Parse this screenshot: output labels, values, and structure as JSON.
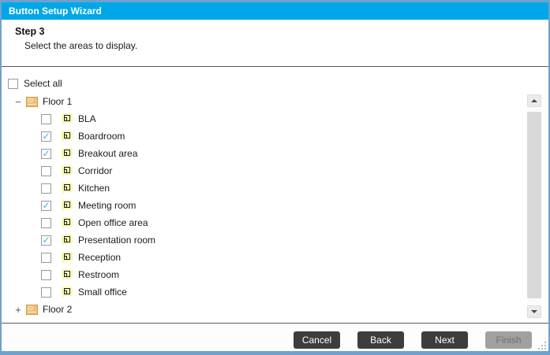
{
  "window": {
    "title": "Button Setup Wizard"
  },
  "header": {
    "step": "Step 3",
    "instruction": "Select the areas to display."
  },
  "select_all": {
    "label": "Select all",
    "checked": false
  },
  "tree": {
    "nodes": [
      {
        "label": "Floor 1",
        "expanded": true,
        "children": [
          {
            "label": "BLA",
            "checked": false
          },
          {
            "label": "Boardroom",
            "checked": true
          },
          {
            "label": "Breakout area",
            "checked": true
          },
          {
            "label": "Corridor",
            "checked": false
          },
          {
            "label": "Kitchen",
            "checked": false
          },
          {
            "label": "Meeting room",
            "checked": true
          },
          {
            "label": "Open office area",
            "checked": false
          },
          {
            "label": "Presentation room",
            "checked": true
          },
          {
            "label": "Reception",
            "checked": false
          },
          {
            "label": "Restroom",
            "checked": false
          },
          {
            "label": "Small office",
            "checked": false
          }
        ]
      },
      {
        "label": "Floor 2",
        "expanded": false,
        "children": []
      }
    ]
  },
  "icons": {
    "collapse_glyph": "−",
    "expand_glyph": "+",
    "check_glyph": "✓",
    "floor_icon": "floor-plan-icon",
    "area_icon": "area-icon",
    "scroll_up": "triangle-up",
    "scroll_down": "triangle-down"
  },
  "footer": {
    "buttons": [
      {
        "label": "Cancel",
        "enabled": true
      },
      {
        "label": "Back",
        "enabled": true
      },
      {
        "label": "Next",
        "enabled": true
      },
      {
        "label": "Finish",
        "enabled": false
      }
    ]
  },
  "colors": {
    "titlebar": "#00a7e8",
    "window_border": "#6fa1cd",
    "check": "#3cb4e7",
    "button_dark": "#3d3d3f",
    "button_disabled": "#a0a0a0",
    "separator": "#5b5b5b"
  }
}
